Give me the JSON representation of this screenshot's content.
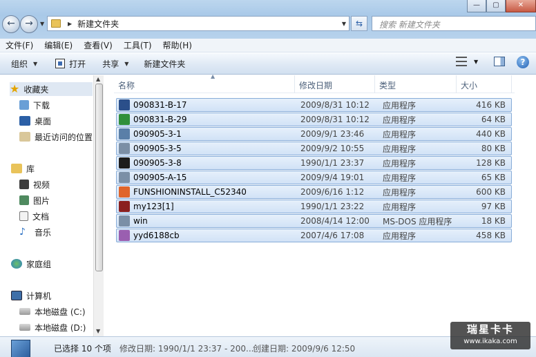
{
  "window": {
    "caption_buttons": [
      "—",
      "▢",
      "✕"
    ]
  },
  "address": {
    "crumb": "新建文件夹",
    "search_placeholder": "搜索 新建文件夹"
  },
  "menubar": [
    {
      "label": "文件(F)"
    },
    {
      "label": "编辑(E)"
    },
    {
      "label": "查看(V)"
    },
    {
      "label": "工具(T)"
    },
    {
      "label": "帮助(H)"
    }
  ],
  "toolbar": {
    "organize": "组织",
    "open": "打开",
    "share": "共享",
    "new_folder": "新建文件夹"
  },
  "nav": {
    "favorites": "收藏夹",
    "downloads": "下载",
    "desktop": "桌面",
    "recent": "最近访问的位置",
    "libraries": "库",
    "videos": "视频",
    "pictures": "图片",
    "documents": "文档",
    "music": "音乐",
    "homegroup": "家庭组",
    "computer": "计算机",
    "disk_c": "本地磁盘 (C:)",
    "disk_d": "本地磁盘 (D:)"
  },
  "columns": {
    "name": "名称",
    "date": "修改日期",
    "type": "类型",
    "size": "大小"
  },
  "files": [
    {
      "name": "090831-B-17",
      "date": "2009/8/31 10:12",
      "type": "应用程序",
      "size": "416 KB",
      "icon_color": "#2b4f8a"
    },
    {
      "name": "090831-B-29",
      "date": "2009/8/31 10:12",
      "type": "应用程序",
      "size": "64 KB",
      "icon_color": "#2f8f3a"
    },
    {
      "name": "090905-3-1",
      "date": "2009/9/1 23:46",
      "type": "应用程序",
      "size": "440 KB",
      "icon_color": "#5a7fa8"
    },
    {
      "name": "090905-3-5",
      "date": "2009/9/2 10:55",
      "type": "应用程序",
      "size": "80 KB",
      "icon_color": "#7b8fa6"
    },
    {
      "name": "090905-3-8",
      "date": "1990/1/1 23:37",
      "type": "应用程序",
      "size": "128 KB",
      "icon_color": "#1c1c1c"
    },
    {
      "name": "090905-A-15",
      "date": "2009/9/4 19:01",
      "type": "应用程序",
      "size": "65 KB",
      "icon_color": "#7b8fa6"
    },
    {
      "name": "FUNSHIONINSTALL_C52340",
      "date": "2009/6/16 1:12",
      "type": "应用程序",
      "size": "600 KB",
      "icon_color": "#e0642a"
    },
    {
      "name": "my123[1]",
      "date": "1990/1/1 23:22",
      "type": "应用程序",
      "size": "97 KB",
      "icon_color": "#8a1f1f"
    },
    {
      "name": "win",
      "date": "2008/4/14 12:00",
      "type": "MS-DOS 应用程序",
      "size": "18 KB",
      "icon_color": "#7b8fa6"
    },
    {
      "name": "yyd6188cb",
      "date": "2007/4/6 17:08",
      "type": "应用程序",
      "size": "458 KB",
      "icon_color": "#9a5fb0"
    }
  ],
  "details": {
    "selected": "已选择 10 个项",
    "modified": "修改日期: 1990/1/1 23:37 - 200...",
    "created": "创建日期: 2009/9/6 12:50"
  },
  "watermark": {
    "line1": "瑞星卡卡",
    "line2": "www.ikaka.com"
  },
  "colors": {
    "selection_fill": "#d9e8f8",
    "selection_border": "#87acd8",
    "chrome": "#bcd6ee"
  }
}
